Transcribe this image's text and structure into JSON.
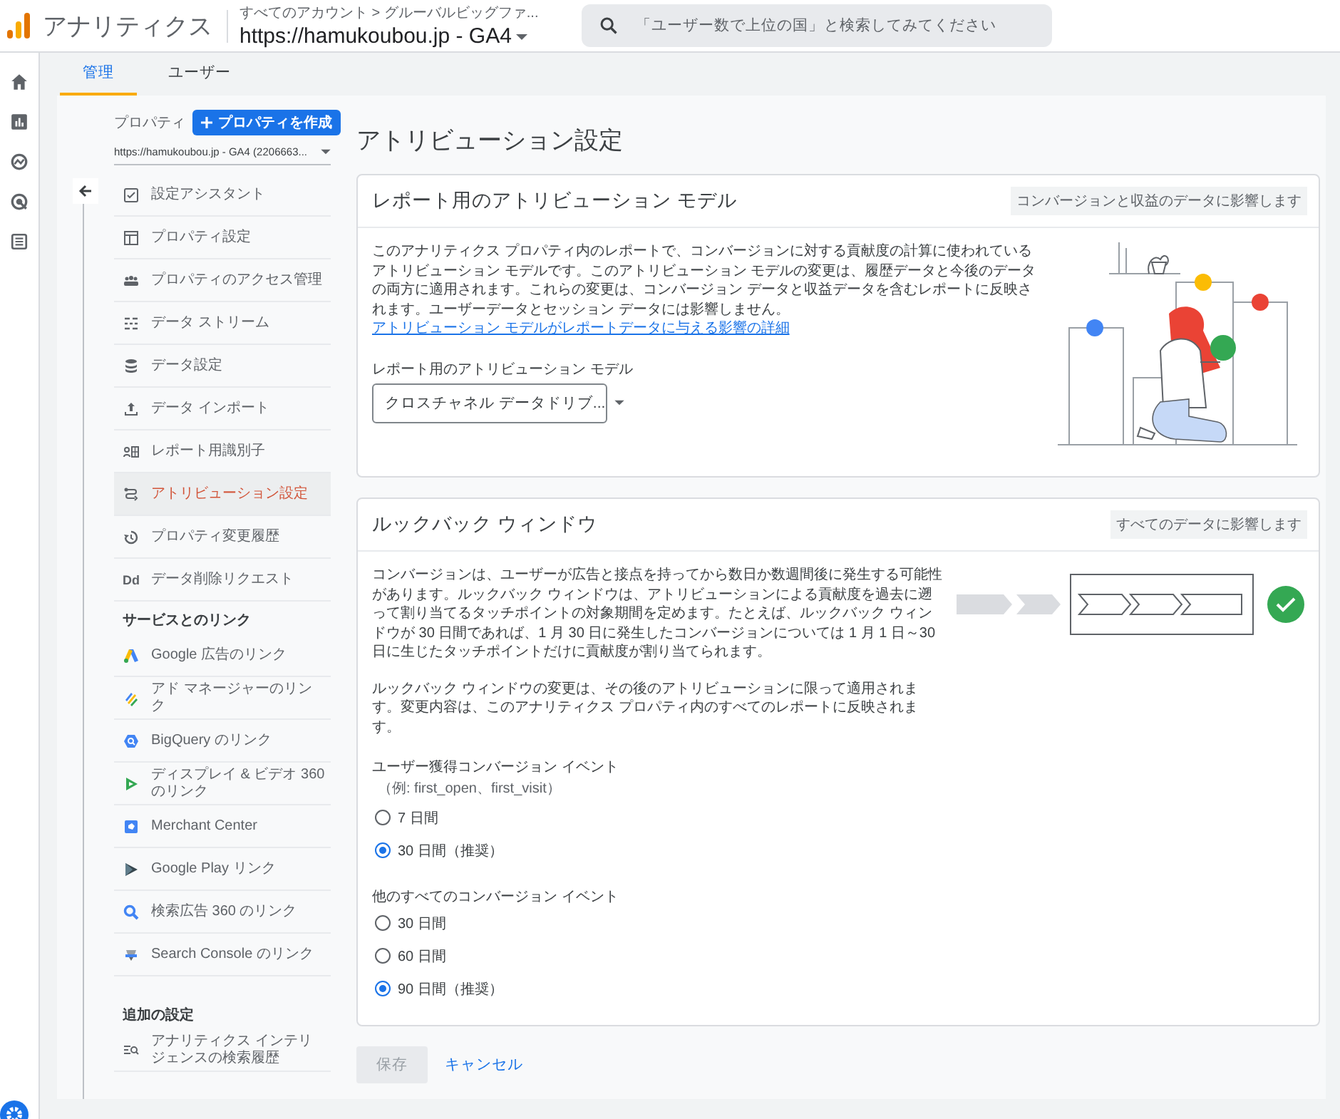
{
  "header": {
    "app_name": "アナリティクス",
    "breadcrumb": "すべてのアカウント > グルーバルビッグファ...",
    "property": "https://hamukoubou.jp - GA4",
    "search": {
      "placeholder": "「ユーザー数で上位の国」と検索してみてください"
    }
  },
  "tabs": [
    {
      "label": "管理",
      "selected": true
    },
    {
      "label": "ユーザー",
      "selected": false
    }
  ],
  "property_panel": {
    "label": "プロパティ",
    "create_button": "プロパティを作成",
    "select_value": "https://hamukoubou.jp - GA4 (2206663..."
  },
  "nav": [
    {
      "kind": "item",
      "label": "設定アシスタント",
      "selected": false
    },
    {
      "kind": "item",
      "label": "プロパティ設定",
      "selected": false
    },
    {
      "kind": "item",
      "label": "プロパティのアクセス管理",
      "selected": false
    },
    {
      "kind": "item",
      "label": "データ ストリーム",
      "selected": false
    },
    {
      "kind": "item",
      "label": "データ設定",
      "selected": false
    },
    {
      "kind": "item",
      "label": "データ インポート",
      "selected": false
    },
    {
      "kind": "item",
      "label": "レポート用識別子",
      "selected": false
    },
    {
      "kind": "item",
      "label": "アトリビューション設定",
      "selected": true
    },
    {
      "kind": "item",
      "label": "プロパティ変更履歴",
      "selected": false
    },
    {
      "kind": "item",
      "label": "データ削除リクエスト",
      "selected": false,
      "icon_text": "Dd"
    },
    {
      "kind": "heading",
      "label": "サービスとのリンク"
    },
    {
      "kind": "item",
      "label": "Google 広告のリンク",
      "selected": false
    },
    {
      "kind": "item",
      "label": "アド マネージャーのリンク",
      "selected": false
    },
    {
      "kind": "item",
      "label": "BigQuery のリンク",
      "selected": false
    },
    {
      "kind": "item",
      "label": "ディスプレイ & ビデオ 360 のリンク",
      "selected": false
    },
    {
      "kind": "item",
      "label": "Merchant Center",
      "selected": false
    },
    {
      "kind": "item",
      "label": "Google Play リンク",
      "selected": false
    },
    {
      "kind": "item",
      "label": "検索広告 360 のリンク",
      "selected": false
    },
    {
      "kind": "item",
      "label": "Search Console のリンク",
      "selected": false
    },
    {
      "kind": "heading",
      "label": "追加の設定"
    },
    {
      "kind": "item",
      "label": "アナリティクス インテリジェンスの検索履歴",
      "selected": false
    }
  ],
  "title": "アトリビューション設定",
  "model_card": {
    "title": "レポート用のアトリビューション モデル",
    "chip": "コンバージョンと収益のデータに影響します",
    "description": "このアナリティクス プロパティ内のレポートで、コンバージョンに対する貢献度の計算に使われているアトリビューション モデルです。このアトリビューション モデルの変更は、履歴データと今後のデータの両方に適用されます。これらの変更は、コンバージョン データと収益データを含むレポートに反映されます。ユーザーデータとセッション データには影響しません。",
    "link": "アトリビューション モデルがレポートデータに与える影響の詳細",
    "field_label": "レポート用のアトリビューション モデル",
    "dropdown_value": "クロスチャネル データドリブ..."
  },
  "lookback_card": {
    "title": "ルックバック ウィンドウ",
    "chip": "すべてのデータに影響します",
    "paragraphs": [
      "コンバージョンは、ユーザーが広告と接点を持ってから数日か数週間後に発生する可能性があります。ルックバック ウィンドウは、アトリビューションによる貢献度を過去に遡って割り当てるタッチポイントの対象期間を定めます。たとえば、ルックバック ウィンドウが 30 日間であれば、1 月 30 日に発生したコンバージョンについては 1 月 1 日～30 日に生じたタッチポイントだけに貢献度が割り当てられます。",
      "ルックバック ウィンドウの変更は、その後のアトリビューションに限って適用されます。変更内容は、このアナリティクス プロパティ内のすべてのレポートに反映されます。"
    ],
    "groups": [
      {
        "label": "ユーザー獲得コンバージョン イベント",
        "hint": "（例: first_open、first_visit）",
        "options": [
          {
            "label": "7 日間",
            "selected": false
          },
          {
            "label": "30 日間（推奨）",
            "selected": true
          }
        ]
      },
      {
        "label": "他のすべてのコンバージョン イベント",
        "options": [
          {
            "label": "30 日間",
            "selected": false
          },
          {
            "label": "60 日間",
            "selected": false
          },
          {
            "label": "90 日間（推奨）",
            "selected": true
          }
        ]
      }
    ]
  },
  "actions": {
    "save": "保存",
    "save_disabled": true,
    "cancel": "キャンセル"
  }
}
